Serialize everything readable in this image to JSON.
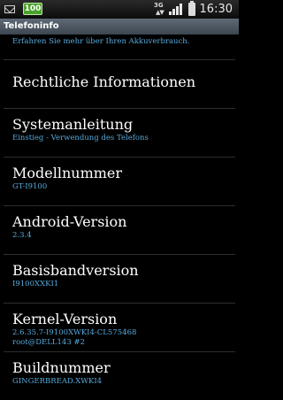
{
  "statusbar": {
    "battery_level": "100",
    "network": "3G",
    "time": "16:30",
    "icons": [
      "email-icon",
      "battery-notification-icon",
      "3g-data-icon",
      "signal-strength-icon",
      "battery-charging-icon"
    ]
  },
  "app": {
    "title": "Telefoninfo"
  },
  "list": {
    "top_note": "Erfahren Sie mehr über Ihren Akkuverbrauch.",
    "items": [
      {
        "title": "Rechtliche Informationen"
      },
      {
        "title": "Systemanleitung",
        "subtitle": "Einstieg - Verwendung des Telefons"
      },
      {
        "title": "Modellnummer",
        "subtitle": "GT-I9100"
      },
      {
        "title": "Android-Version",
        "subtitle": "2.3.4"
      },
      {
        "title": "Basisbandversion",
        "subtitle": "I9100XXKI1"
      },
      {
        "title": "Kernel-Version",
        "subtitle": "2.6.35.7-I9100XWKI4-CL575468",
        "subtitle2": "root@DELL143 #2"
      },
      {
        "title": "Buildnummer",
        "subtitle": "GINGERBREAD.XWKI4"
      }
    ]
  },
  "colors": {
    "accent": "#58aadc",
    "background": "#000000",
    "title_bar": "#4a5560"
  }
}
